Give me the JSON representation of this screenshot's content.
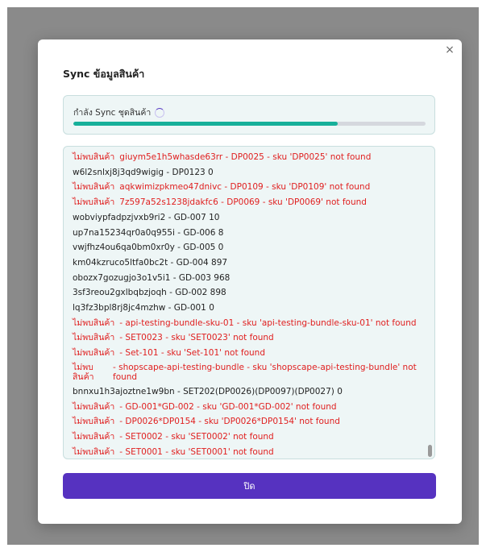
{
  "modal": {
    "title": "Sync ข้อมูลสินค้า",
    "close_icon": "×",
    "close_button_label": "ปิด"
  },
  "progress": {
    "label": "กำลัง Sync ชุดสินค้า",
    "value": 0.75,
    "fill_color": "#17b09a"
  },
  "log": [
    {
      "type": "err",
      "prefix": "ไม่พบสินค้า",
      "text": "giuym5e1h5whasde63rr - DP0025 - sku 'DP0025' not found"
    },
    {
      "type": "ok",
      "text": "w6l2snlxj8j3qd9wigig - DP0123 0"
    },
    {
      "type": "err",
      "prefix": "ไม่พบสินค้า",
      "text": "aqkwimizpkmeo47dnivc - DP0109 - sku 'DP0109' not found"
    },
    {
      "type": "err",
      "prefix": "ไม่พบสินค้า",
      "text": "7z597a52s1238jdakfc6 - DP0069 - sku 'DP0069' not found"
    },
    {
      "type": "ok",
      "text": "wobviypfadpzjvxb9ri2 - GD-007 10"
    },
    {
      "type": "ok",
      "text": "up7na15234qr0a0q955i - GD-006 8"
    },
    {
      "type": "ok",
      "text": "vwjfhz4ou6qa0bm0xr0y - GD-005 0"
    },
    {
      "type": "ok",
      "text": "km04kzruco5ltfa0bc2t - GD-004 897"
    },
    {
      "type": "ok",
      "text": "obozx7gozugjo3o1v5i1 - GD-003 968"
    },
    {
      "type": "ok",
      "text": "3sf3reou2gxlbqbzjoqh - GD-002 898"
    },
    {
      "type": "ok",
      "text": "lq3fz3bpl8rj8jc4mzhw - GD-001 0"
    },
    {
      "type": "err",
      "prefix": "ไม่พบสินค้า",
      "text": "- api-testing-bundle-sku-01 - sku 'api-testing-bundle-sku-01' not found"
    },
    {
      "type": "err",
      "prefix": "ไม่พบสินค้า",
      "text": "- SET0023 - sku 'SET0023' not found"
    },
    {
      "type": "err",
      "prefix": "ไม่พบสินค้า",
      "text": "- Set-101 - sku 'Set-101' not found"
    },
    {
      "type": "err",
      "wrap": true,
      "prefix": "ไม่พบสินค้า",
      "text": "- shopscape-api-testing-bundle - sku 'shopscape-api-testing-bundle' not found"
    },
    {
      "type": "ok",
      "text": "bnnxu1h3ajoztne1w9bn - SET202(DP0026)(DP0097)(DP0027) 0"
    },
    {
      "type": "err",
      "prefix": "ไม่พบสินค้า",
      "text": "- GD-001*GD-002 - sku 'GD-001*GD-002' not found"
    },
    {
      "type": "err",
      "prefix": "ไม่พบสินค้า",
      "text": "- DP0026*DP0154 - sku 'DP0026*DP0154' not found"
    },
    {
      "type": "err",
      "prefix": "ไม่พบสินค้า",
      "text": "- SET0002 - sku 'SET0002' not found"
    },
    {
      "type": "err",
      "prefix": "ไม่พบสินค้า",
      "text": "- SET0001 - sku 'SET0001' not found"
    }
  ]
}
